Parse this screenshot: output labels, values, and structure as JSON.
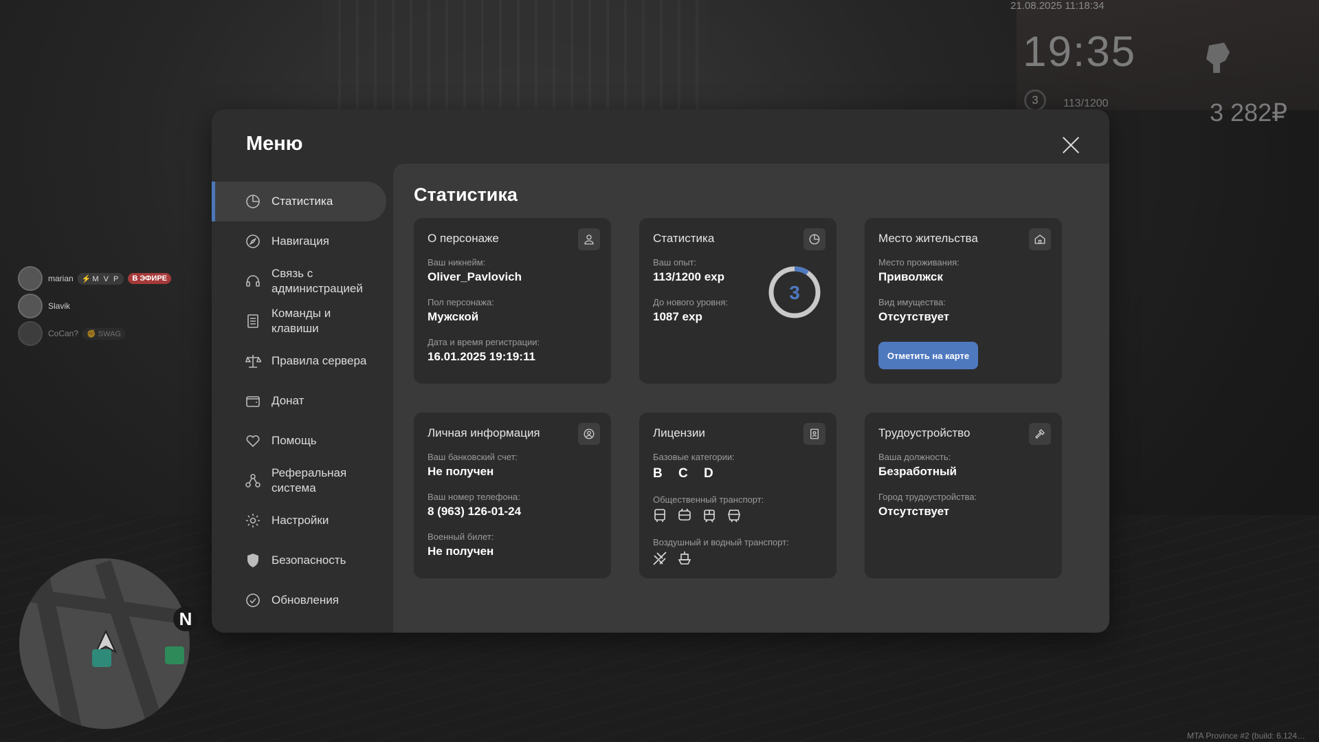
{
  "hud": {
    "datetime": "21.08.2025 11:18:34",
    "clock": "19:35",
    "level": "3",
    "exp": "113/1200",
    "money": "3 282₽"
  },
  "chat": [
    {
      "name": "marian",
      "badge": "⚡M V P",
      "live": "В ЭФИРЕ"
    },
    {
      "name": "Slavik"
    },
    {
      "name": "CoCan?",
      "badge": "✊ SWAG"
    }
  ],
  "minimap": {
    "north": "N"
  },
  "footer": {
    "build": "MTA Province #2 (build: 6.124…"
  },
  "menu": {
    "title": "Меню",
    "sidebar": [
      {
        "label": "Статистика",
        "icon": "pie-chart-icon"
      },
      {
        "label": "Навигация",
        "icon": "compass-icon"
      },
      {
        "label": "Связь с администрацией",
        "icon": "headset-icon"
      },
      {
        "label": "Команды и клавиши",
        "icon": "document-list-icon"
      },
      {
        "label": "Правила сервера",
        "icon": "scales-icon"
      },
      {
        "label": "Донат",
        "icon": "wallet-icon"
      },
      {
        "label": "Помощь",
        "icon": "heart-handshake-icon"
      },
      {
        "label": "Реферальная система",
        "icon": "referral-network-icon"
      },
      {
        "label": "Настройки",
        "icon": "gear-icon"
      },
      {
        "label": "Безопасность",
        "icon": "shield-icon"
      },
      {
        "label": "Обновления",
        "icon": "check-circle-icon"
      }
    ],
    "content_title": "Статистика",
    "cards": {
      "character": {
        "title": "О персонаже",
        "nickname_label": "Ваш никнейм:",
        "nickname": "Oliver_Pavlovich",
        "gender_label": "Пол персонажа:",
        "gender": "Мужской",
        "reg_label": "Дата и время регистрации:",
        "reg": "16.01.2025 19:19:11"
      },
      "stats": {
        "title": "Статистика",
        "exp_label": "Ваш опыт:",
        "exp": "113/1200 exp",
        "next_label": "До нового уровня:",
        "next": "1087 exp",
        "level": "3",
        "progress": 0.094
      },
      "residence": {
        "title": "Место жительства",
        "place_label": "Место проживания:",
        "place": "Приволжск",
        "property_label": "Вид имущества:",
        "property": "Отсутствует",
        "button": "Отметить на карте"
      },
      "personal": {
        "title": "Личная информация",
        "bank_label": "Ваш банковский счет:",
        "bank": "Не получен",
        "phone_label": "Ваш номер телефона:",
        "phone": "8 (963) 126-01-24",
        "military_label": "Военный билет:",
        "military": "Не получен"
      },
      "licenses": {
        "title": "Лицензии",
        "base_label": "Базовые категории:",
        "base": "B C D",
        "public_label": "Общественный транспорт:",
        "air_label": "Воздушный и водный транспорт:"
      },
      "job": {
        "title": "Трудоустройство",
        "position_label": "Ваша должность:",
        "position": "Безработный",
        "city_label": "Город трудоустройства:",
        "city": "Отсутствует"
      }
    }
  },
  "colors": {
    "accent": "#4f79bf",
    "panel": "#2e2e2e",
    "card": "#2c2c2c",
    "live": "#a63a3a"
  }
}
